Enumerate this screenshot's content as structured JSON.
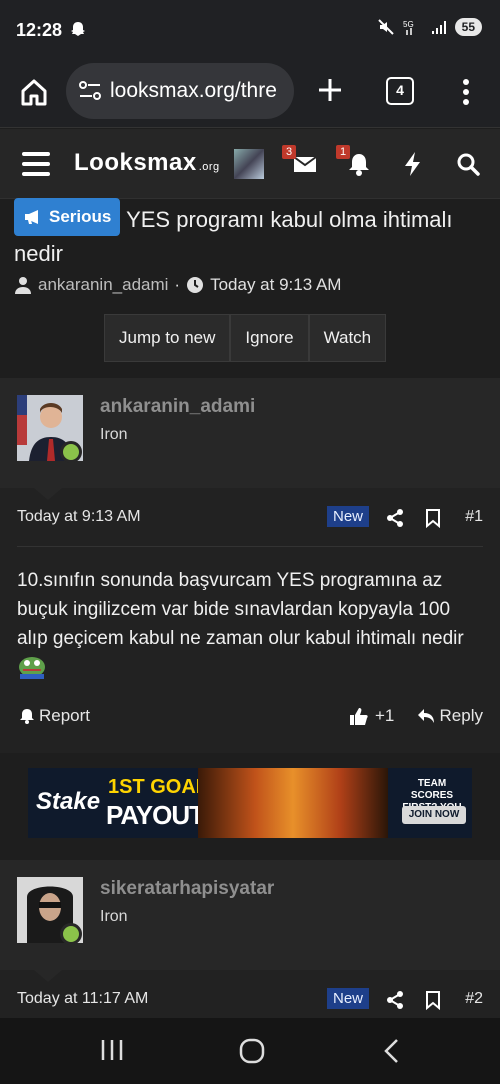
{
  "status_bar": {
    "time": "12:28",
    "battery": "55"
  },
  "browser": {
    "url": "looksmax.org/thre",
    "tab_count": "4"
  },
  "site_header": {
    "logo_text": "Lᴏᴏksmax",
    "logo_suffix": ".org",
    "inbox_badge": "3",
    "alerts_badge": "1"
  },
  "thread": {
    "prefix": "Serious",
    "title": "YES programı kabul olma ihtimalı nedir",
    "author": "ankaranin_adami",
    "separator": "·",
    "date": "Today at 9:13 AM",
    "actions": [
      "Jump to new",
      "Ignore",
      "Watch"
    ]
  },
  "posts": [
    {
      "username": "ankaranin_adami",
      "rank": "Iron",
      "date": "Today at 9:13 AM",
      "new_label": "New",
      "number": "#1",
      "body": "10.sınıfın sonunda başvurcam YES programına az buçuk ingilizcem var bide sınavlardan kopyayla 100 alıp geçicem kabul ne zaman olur kabul ihtimalı nedir",
      "report_label": "Report",
      "like_count": "+1",
      "reply_label": "Reply"
    },
    {
      "username": "sikeratarhapisyatar",
      "rank": "Iron",
      "date": "Today at 11:17 AM",
      "new_label": "New",
      "number": "#2"
    }
  ],
  "ad": {
    "brand": "Stake",
    "goal_text": "1ST GOAL",
    "payout_text": "PAYOUT",
    "team_text": "TEAM SCORES FIRST? YOU WIN!",
    "join_label": "JOIN NOW"
  },
  "colors": {
    "prefix_blue": "#2f80d1",
    "online_green": "#8bc34a",
    "new_badge": "#1e3f8a",
    "badge_red": "#c0392b"
  }
}
